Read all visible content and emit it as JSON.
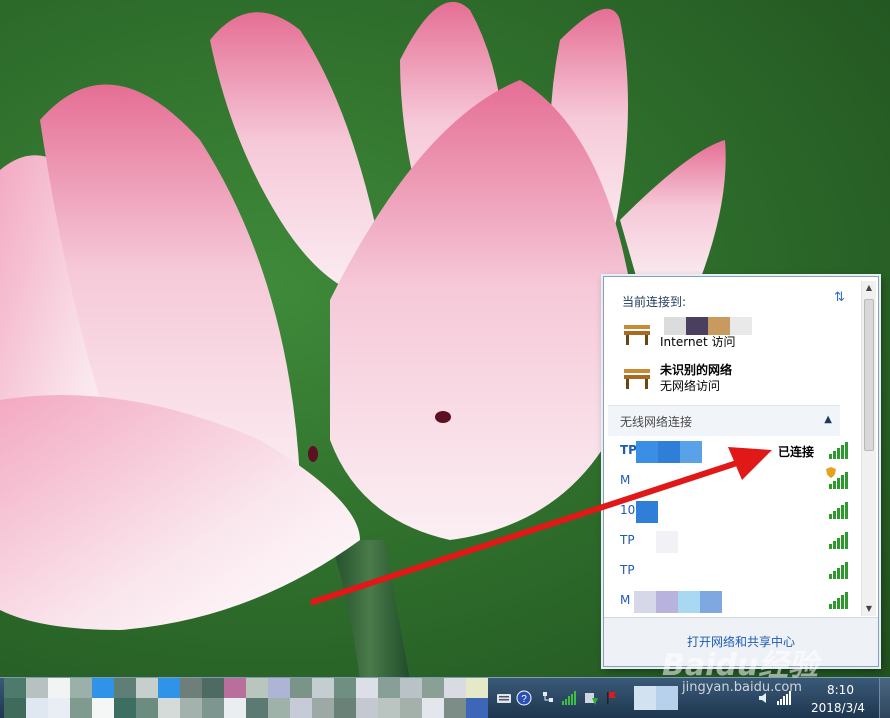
{
  "popup": {
    "current_header": "当前连接到:",
    "connections": [
      {
        "name": "",
        "status": "Internet 访问",
        "blur_colors": [
          "#dcdcdc",
          "#4a3f5e",
          "#c99a5e",
          "#e9e9e9"
        ]
      },
      {
        "name": "未识别的网络",
        "status": "无网络访问"
      }
    ],
    "wireless_section_title": "无线网络连接",
    "networks": [
      {
        "ssid": "TP",
        "bold": true,
        "status": "已连接",
        "blur_colors": [
          "#3b8ee6",
          "#2f7fd8",
          "#5aa2e8"
        ],
        "secured_warning": false
      },
      {
        "ssid": "M",
        "bold": false,
        "status": "",
        "blur_colors": [],
        "secured_warning": true
      },
      {
        "ssid": "10",
        "bold": false,
        "status": "",
        "blur_colors": [
          "#2f7fd8"
        ],
        "secured_warning": false
      },
      {
        "ssid": "TP",
        "bold": false,
        "status": "",
        "blur_colors": [
          "#f1f1f6",
          "#e7e9f3"
        ],
        "secured_warning": false
      },
      {
        "ssid": "TP",
        "bold": false,
        "status": "",
        "blur_colors": [],
        "secured_warning": false
      },
      {
        "ssid": "M",
        "bold": false,
        "status": "",
        "blur_colors": [
          "#d7d7ea",
          "#b7b2de",
          "#a9d8f3",
          "#7fa8e0"
        ],
        "secured_warning": false
      }
    ],
    "footer_link": "打开网络和共享中心"
  },
  "taskbar": {
    "time": "8:10",
    "date": "2018/3/4",
    "pixel_colors": [
      "#4d7a6b",
      "#b6c1c0",
      "#f2f4f3",
      "#9bb0a9",
      "#2f93e8",
      "#5f7f76",
      "#c6cfcc",
      "#2f93e8",
      "#6e7f7a",
      "#4d6a63",
      "#b96f9c",
      "#b8c6be",
      "#aeb4d6",
      "#7b9489",
      "#c4cdd0",
      "#6f8f82",
      "#dcdfe6",
      "#889f97",
      "#b9c2c6",
      "#8aa097",
      "#d8dbe2",
      "#e5e9c8",
      "#efe69c",
      "#3f6a5c",
      "#dfe7f1",
      "#e9eef5",
      "#7f9a8e",
      "#f5f7f6",
      "#3c6f62",
      "#6d8c80",
      "#d5dbd9",
      "#a3b2ad",
      "#7e9690",
      "#eaeef0",
      "#5c7a71",
      "#9eb2aa",
      "#c7cbd8",
      "#9ca9a4",
      "#6a8177",
      "#c3c9cf",
      "#bac4c0",
      "#a4b1ab",
      "#e3e6ec",
      "#7c8d88",
      "#3e66b8",
      "#f4f4f4"
    ],
    "tray_icons": [
      "keyboard-icon",
      "help-icon",
      "network-adapter-icon",
      "signal-icon",
      "safety-icon",
      "flag-icon"
    ]
  },
  "watermark": {
    "logo": "Baidu经验",
    "url": "jingyan.baidu.com"
  }
}
